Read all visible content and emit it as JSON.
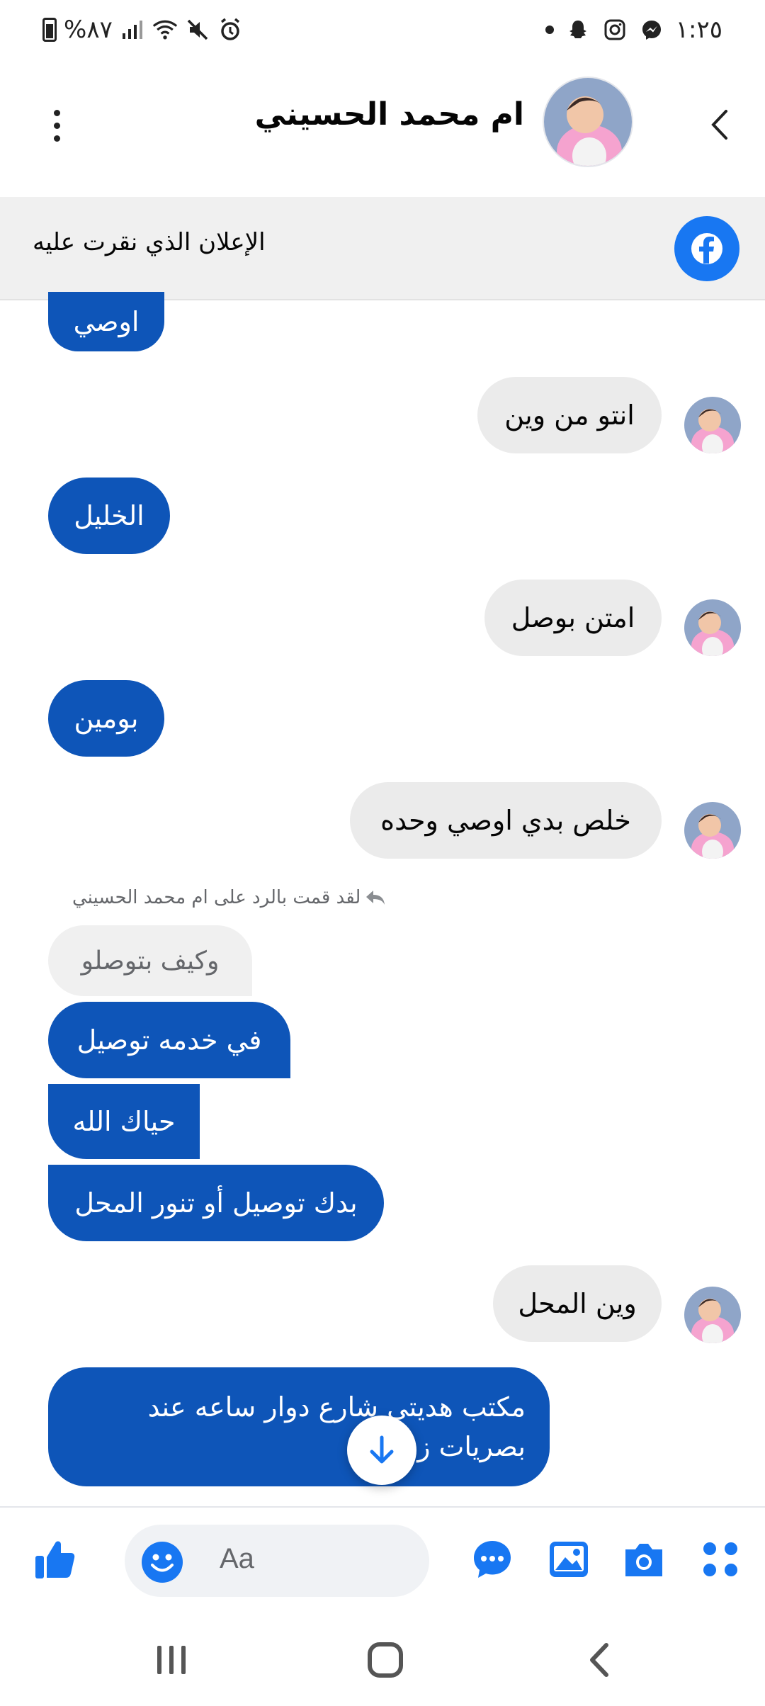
{
  "status_bar": {
    "battery": "%٨٧",
    "time": "١:٢٥"
  },
  "header": {
    "contact_name": "ام محمد الحسيني"
  },
  "ad_banner": {
    "text": "الإعلان الذي نقرت عليه"
  },
  "messages": [
    {
      "text": "اوصي",
      "direction": "outgoing"
    },
    {
      "text": "انتو من وين",
      "direction": "incoming"
    },
    {
      "text": "الخليل",
      "direction": "outgoing"
    },
    {
      "text": "امتن بوصل",
      "direction": "incoming"
    },
    {
      "text": "بومين",
      "direction": "outgoing"
    },
    {
      "text": "خلص بدي اوصي وحده",
      "direction": "incoming"
    },
    {
      "text": "في خدمه توصيل",
      "direction": "outgoing"
    },
    {
      "text": "حياك الله",
      "direction": "outgoing"
    },
    {
      "text": "بدك توصيل أو تنور المحل",
      "direction": "outgoing"
    },
    {
      "text": "وين المحل",
      "direction": "incoming"
    },
    {
      "text_line1": "مكتب هديتي شارع دوار ساعه عند",
      "text_line2": "بصريات زم",
      "direction": "outgoing"
    }
  ],
  "reply": {
    "note": "لقد قمت بالرد على ام محمد الحسيني",
    "quoted_text": "وكيف بتوصلو"
  },
  "composer": {
    "placeholder": "Aa"
  },
  "colors": {
    "outgoing_bubble": "#0e55b8",
    "incoming_bubble": "#ebebeb",
    "accent": "#1877f2"
  },
  "icons": [
    "back-icon",
    "more-icon",
    "facebook-icon",
    "scroll-down-icon",
    "grid-menu-icon",
    "camera-icon",
    "gallery-icon",
    "chat-icon",
    "emoji-icon",
    "like-icon"
  ]
}
